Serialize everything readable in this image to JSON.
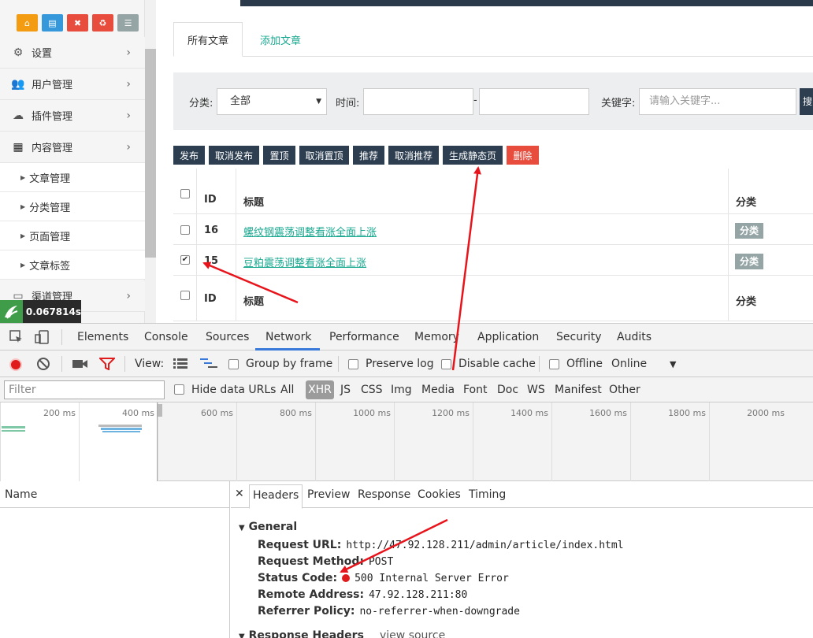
{
  "sidebar": {
    "quick_buttons": [
      {
        "icon": "home-icon",
        "color": "#f39c12",
        "glyph": "⌂"
      },
      {
        "icon": "file-icon",
        "color": "#3498db",
        "glyph": "▤"
      },
      {
        "icon": "trash-icon",
        "color": "#e74c3c",
        "glyph": "🗑"
      },
      {
        "icon": "recycle-icon",
        "color": "#e74c3c",
        "glyph": "♻"
      },
      {
        "icon": "list-icon",
        "color": "#95a5a6",
        "glyph": "☰"
      }
    ],
    "menus": [
      {
        "label": "设置",
        "icon": "gears-icon"
      },
      {
        "label": "用户管理",
        "icon": "users-icon"
      },
      {
        "label": "插件管理",
        "icon": "cloud-icon"
      },
      {
        "label": "内容管理",
        "icon": "grid-icon"
      }
    ],
    "submenu": [
      "文章管理",
      "分类管理",
      "页面管理",
      "文章标签"
    ],
    "channel": {
      "label": "渠道管理",
      "icon": "monitor-icon"
    },
    "timer": "0.067814s"
  },
  "tabs": {
    "active": "所有文章",
    "other": "添加文章"
  },
  "filter": {
    "category_label": "分类:",
    "category_value": "全部",
    "time_label": "时间:",
    "dash": "-",
    "keyword_label": "关键字:",
    "keyword_placeholder": "请输入关键字...",
    "search_button": "搜"
  },
  "actions": [
    "发布",
    "取消发布",
    "置顶",
    "取消置顶",
    "推荐",
    "取消推荐",
    "生成静态页",
    "删除"
  ],
  "table": {
    "headers": {
      "id": "ID",
      "title": "标题",
      "category": "分类"
    },
    "rows": [
      {
        "id": "16",
        "title": "螺纹钢震荡调整看涨全面上涨",
        "category": "分类",
        "checked": false
      },
      {
        "id": "15",
        "title": "豆粕震荡调整看涨全面上涨",
        "category": "分类",
        "checked": true
      }
    ]
  },
  "devtools": {
    "tabs": [
      "Elements",
      "Console",
      "Sources",
      "Network",
      "Performance",
      "Memory",
      "Application",
      "Security",
      "Audits"
    ],
    "active_tab": "Network",
    "toolbar": {
      "view": "View:",
      "group_by_frame": "Group by frame",
      "preserve_log": "Preserve log",
      "disable_cache": "Disable cache",
      "offline": "Offline",
      "online": "Online"
    },
    "filter_placeholder": "Filter",
    "hide_data_urls": "Hide data URLs",
    "types": [
      "All",
      "XHR",
      "JS",
      "CSS",
      "Img",
      "Media",
      "Font",
      "Doc",
      "WS",
      "Manifest",
      "Other"
    ],
    "timeline_ticks": [
      "200 ms",
      "400 ms",
      "600 ms",
      "800 ms",
      "1000 ms",
      "1200 ms",
      "1400 ms",
      "1600 ms",
      "1800 ms",
      "2000 ms"
    ],
    "name_header": "Name",
    "detail_tabs": [
      "Headers",
      "Preview",
      "Response",
      "Cookies",
      "Timing"
    ],
    "general": {
      "title": "General",
      "request_url_k": "Request URL:",
      "request_url_v": "http://47.92.128.211/admin/article/index.html",
      "method_k": "Request Method:",
      "method_v": "POST",
      "status_k": "Status Code:",
      "status_v": "500 Internal Server Error",
      "remote_k": "Remote Address:",
      "remote_v": "47.92.128.211:80",
      "referrer_k": "Referrer Policy:",
      "referrer_v": "no-referrer-when-downgrade"
    },
    "response_headers": "Response Headers",
    "view_source": "view source"
  },
  "annotation_color": "#e8141b"
}
